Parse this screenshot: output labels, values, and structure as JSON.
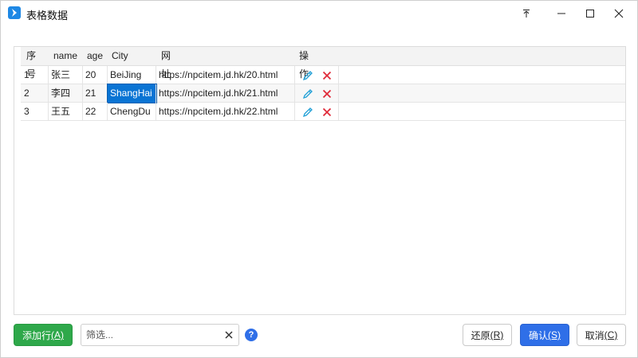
{
  "window": {
    "title": "表格数据"
  },
  "table": {
    "headers": [
      "序号",
      "name",
      "age",
      "City",
      "网址",
      "操作"
    ],
    "rows": [
      {
        "idx": "1",
        "name": "张三",
        "age": "20",
        "city": "BeiJing",
        "url": "https://npcitem.jd.hk/20.html"
      },
      {
        "idx": "2",
        "name": "李四",
        "age": "21",
        "city": "ShangHai",
        "url": "https://npcitem.jd.hk/21.html"
      },
      {
        "idx": "3",
        "name": "王五",
        "age": "22",
        "city": "ChengDu",
        "url": "https://npcitem.jd.hk/22.html"
      }
    ],
    "selected_cell": {
      "row": 2,
      "column": "City"
    }
  },
  "footer": {
    "add_row": "添加行",
    "add_row_key": "(A)",
    "filter_placeholder": "筛选...",
    "help": "?",
    "reset": "还原",
    "reset_key": "(R)",
    "ok": "确认",
    "ok_key": "(S)",
    "cancel": "取消",
    "cancel_key": "(C)"
  },
  "colors": {
    "add_button": "#2ea84a",
    "ok_button": "#2f6fe8",
    "selection": "#0a74d4",
    "edit_icon": "#1f9fd6",
    "delete_icon": "#e02b3a"
  },
  "icons": {
    "app": "app-logo-icon",
    "pin": "pin-icon",
    "minimize": "minimize-icon",
    "maximize": "maximize-icon",
    "close": "close-icon",
    "edit": "pencil-icon",
    "delete": "delete-x-icon",
    "clear": "clear-x-icon",
    "help": "help-icon"
  }
}
